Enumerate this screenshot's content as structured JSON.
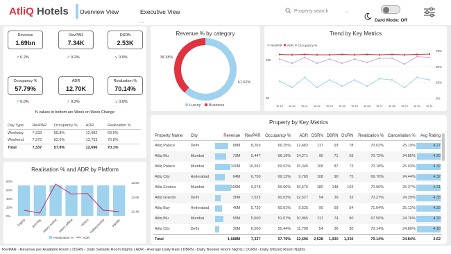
{
  "header": {
    "brand_a": "AtliQ",
    "brand_b": "Hotels",
    "tabs": [
      "Overview View",
      "Executive View"
    ],
    "search_placeholder": "Property search",
    "dark_mode_label": "Dard Mode: Off"
  },
  "kpis": [
    {
      "title": "Revenue",
      "value": "1.69bn",
      "change": "0.2%",
      "dir": "up"
    },
    {
      "title": "RevPAR",
      "value": "7.34K",
      "change": "0.2%",
      "dir": "up"
    },
    {
      "title": "DSRN",
      "value": "2.53K",
      "change": "0.0%",
      "dir": "down"
    },
    {
      "title": "Occupancy %",
      "value": "57.79%",
      "change": "0.0%",
      "dir": "up"
    },
    {
      "title": "ADR",
      "value": "12.70K",
      "change": "0.2%",
      "dir": "up"
    },
    {
      "title": "Realization %",
      "value": "70.14%",
      "change": "0.0%",
      "dir": "down"
    }
  ],
  "kpi_note": "% values in bottom are Week on Week Change",
  "daytype_table": {
    "headers": [
      "Day Type",
      "RevPAR",
      "Occupancy %",
      "ADR",
      "Realization %"
    ],
    "rows": [
      [
        "Weekday",
        "7,333",
        "55.8%",
        "12,682",
        "69.9%"
      ],
      [
        "Weekend",
        "7,372",
        "62.6%",
        "12,753",
        "70.8%"
      ]
    ],
    "total": [
      "Total",
      "7,337",
      "57.8%",
      "12,696",
      "70.1%"
    ]
  },
  "revenue_category": {
    "title": "Revenue % by category",
    "slices": [
      {
        "name": "Luxury",
        "value": 61.62,
        "label": "61.62%",
        "color": "#9fd2ef"
      },
      {
        "name": "Business",
        "value": 38.38,
        "label": "38.38%",
        "color": "#e0333f"
      }
    ]
  },
  "trend": {
    "title": "Trend by Key Metrics",
    "legend": [
      "RevPAR",
      "ADR",
      "Occupancy %"
    ],
    "weeks": [
      "W 19",
      "W 20",
      "W 21",
      "W 22",
      "W 23",
      "W 24",
      "W 25",
      "W 26",
      "W 27",
      "W 28",
      "W 29",
      "W 30",
      "W 31"
    ],
    "left_axis": [
      "10K",
      "",
      "0K"
    ],
    "right_axis": [
      "75%",
      "50%",
      "25%",
      "0%"
    ],
    "adr": [
      13.1,
      13.0,
      13.1,
      13.0,
      13.0,
      13.1,
      13.0,
      13.1,
      13.0,
      13.1,
      13.0,
      13.1,
      13.2
    ],
    "revpar": [
      7.5,
      7.0,
      7.8,
      7.0,
      7.6,
      7.1,
      7.6,
      7.1,
      7.7,
      7.6,
      7.0,
      7.8,
      7.6
    ],
    "occupancy": [
      62,
      57,
      64,
      57,
      62,
      57,
      62,
      58,
      63,
      63,
      56,
      65,
      64
    ]
  },
  "platform": {
    "title": "Realisation % and ADR by Platform",
    "categories": [
      "logtrip",
      "journey",
      "direct online",
      "direct offline",
      "others",
      "makeyourtrip",
      "tripster"
    ],
    "realization": [
      70.0,
      70.1,
      70.3,
      70.0,
      70.1,
      70.2,
      70.0
    ],
    "adr": [
      12420,
      12380,
      12780,
      12640,
      12650,
      12420,
      12400
    ],
    "left_axis": [
      "80%",
      "60%",
      "40%",
      "20%",
      "0%"
    ],
    "right_axis": [
      "12.8K",
      "12.6K",
      "12.4K"
    ],
    "legend": [
      "Realization %",
      "ADR"
    ]
  },
  "property_table": {
    "title": "Property by Key Metrics",
    "headers": [
      "Property Name",
      "City",
      "Revenue",
      "RevPAR",
      "Occupancy %",
      "ADR",
      "DSRN",
      "DBRN",
      "DURN",
      "Realization %",
      "Cancellation %",
      "Avg Rating"
    ],
    "rows": [
      [
        "Atliq Palace",
        "Delhi",
        "88M",
        "8,269",
        "66.25%",
        "12,482",
        "117",
        "93",
        "78",
        "70.02%",
        "25.19%",
        "4.27"
      ],
      [
        "Atliq Blu",
        "Mumbai",
        "73M",
        "9,447",
        "66.19%",
        "14,271",
        "90",
        "71",
        "59",
        "70.72%",
        "24.85%",
        "4.26"
      ],
      [
        "Atliq Palace",
        "Mumbai",
        "100M",
        "10,592",
        "69.02%",
        "15,345",
        "108",
        "87",
        "73",
        "70.18%",
        "25.03%",
        "4.32"
      ],
      [
        "Atliq City",
        "Hyderabad",
        "64M",
        "6,750",
        "69.12%",
        "9,765",
        "108",
        "90",
        "75",
        "69.70%",
        "24.44%",
        "4.32"
      ],
      [
        "Atliq Exotica",
        "Mumbai",
        "106M",
        "9,078",
        "69.96%",
        "15,576",
        "180",
        "148",
        "103",
        "70.06%",
        "25.37%",
        "4.31"
      ],
      [
        "Atliq Grands",
        "Delhi",
        "36M",
        "7,525",
        "60.03%",
        "12,527",
        "54",
        "39",
        "33",
        "70.27%",
        "24.29%",
        "4.33"
      ],
      [
        "Atliq Bay",
        "Hyderabad",
        "46M",
        "5,720",
        "60.01%",
        "9,525",
        "90",
        "69",
        "54",
        "71.04%",
        "25.12%",
        "4.33"
      ],
      [
        "Atliq Blu",
        "Mumbai",
        "55M",
        "5,600",
        "51.07%",
        "10,965",
        "117",
        "74",
        "60",
        "67.50%",
        "24.76%",
        "4.29"
      ],
      [
        "Atliq City",
        "Delhi",
        "30M",
        "6,500",
        "55.44%",
        "11,790",
        "54",
        "36",
        "30",
        "70.14%",
        "24.80%",
        "4.18"
      ]
    ],
    "total": [
      "Total",
      "",
      "1,688M",
      "7,337",
      "57.79%",
      "12,696",
      "2,528",
      "1,930",
      "1,330",
      "70.14%",
      "24.84%",
      "3.62"
    ],
    "revenue_bars": [
      0.48,
      0.4,
      0.55,
      0.35,
      0.58,
      0.2,
      0.25,
      0.3,
      0.16
    ],
    "rating_bars": [
      0.96,
      0.95,
      0.97,
      0.97,
      0.97,
      0.97,
      0.97,
      0.96,
      0.94
    ]
  },
  "footer": "RevPAR - Revenue per Available Room | DSRN - Daily Sellable Room Nights | ADR - Average Daily Rate | DBRN - Daily Booked Room Nights | DURN - Daily Utilized Room Nights"
}
